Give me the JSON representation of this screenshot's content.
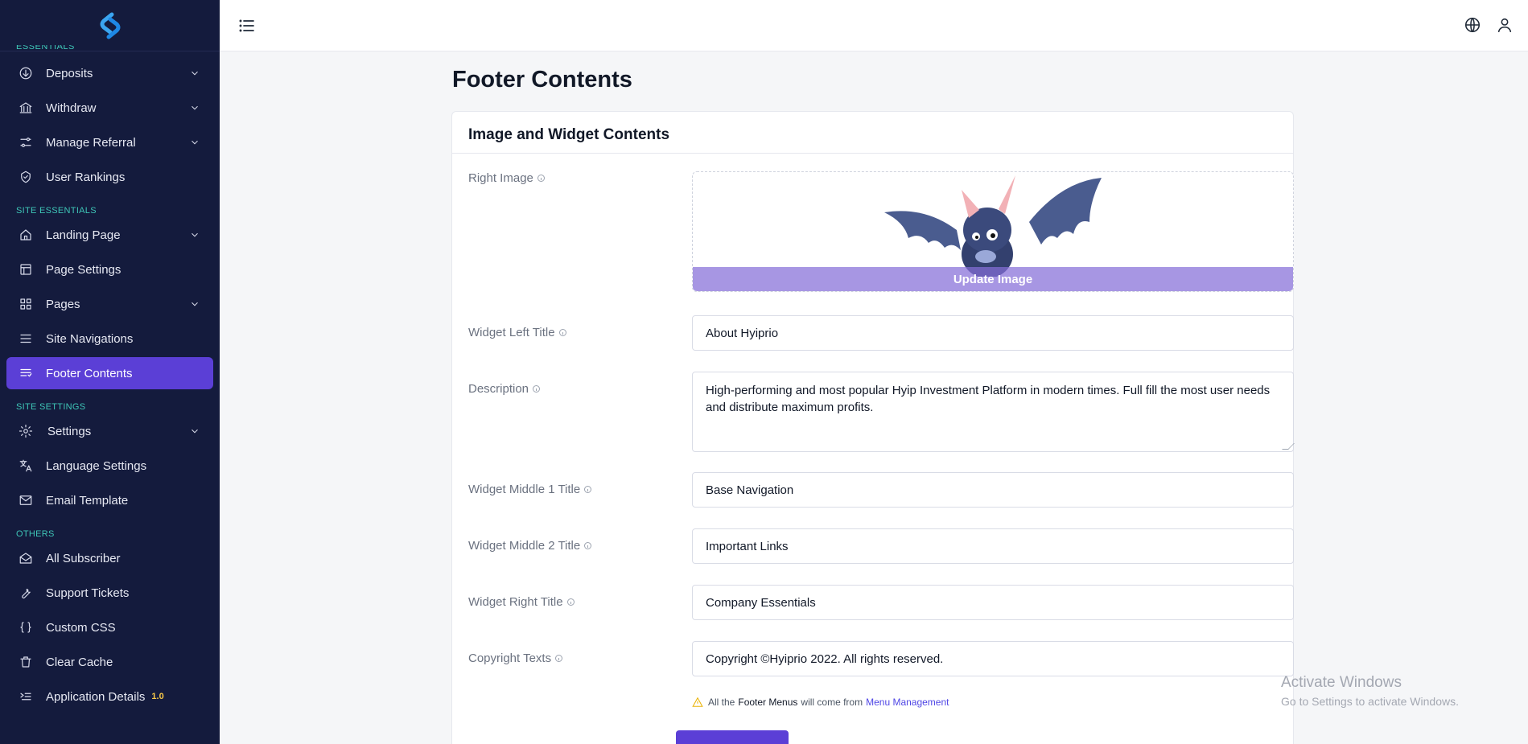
{
  "sidebar": {
    "cut_section": "ESSENTIALS",
    "items_top": [
      {
        "label": "Deposits",
        "icon": "arrow-down-circle-icon",
        "chevron": true
      },
      {
        "label": "Withdraw",
        "icon": "bank-icon",
        "chevron": true
      },
      {
        "label": "Manage Referral",
        "icon": "sliders-icon",
        "chevron": true
      },
      {
        "label": "User Rankings",
        "icon": "badge-icon",
        "chevron": false
      }
    ],
    "section_site_essentials": "SITE ESSENTIALS",
    "items_essentials": [
      {
        "label": "Landing Page",
        "icon": "home-icon",
        "chevron": true
      },
      {
        "label": "Page Settings",
        "icon": "layout-icon",
        "chevron": false
      },
      {
        "label": "Pages",
        "icon": "grid-icon",
        "chevron": true
      },
      {
        "label": "Site Navigations",
        "icon": "menu-icon",
        "chevron": false
      },
      {
        "label": "Footer Contents",
        "icon": "list-lines-icon",
        "chevron": false,
        "active": true
      }
    ],
    "section_site_settings": "SITE SETTINGS",
    "items_settings": [
      {
        "label": "Settings",
        "icon": "gear-icon",
        "chevron": true
      },
      {
        "label": "Language Settings",
        "icon": "translate-icon",
        "chevron": false
      },
      {
        "label": "Email Template",
        "icon": "mail-icon",
        "chevron": false
      }
    ],
    "section_others": "OTHERS",
    "items_others": [
      {
        "label": "All Subscriber",
        "icon": "mail-open-icon",
        "chevron": false
      },
      {
        "label": "Support Tickets",
        "icon": "wrench-icon",
        "chevron": false
      },
      {
        "label": "Custom CSS",
        "icon": "braces-icon",
        "chevron": false
      },
      {
        "label": "Clear Cache",
        "icon": "trash-icon",
        "chevron": false
      },
      {
        "label": "Application Details",
        "icon": "terminal-icon",
        "chevron": false,
        "badge": "1.0"
      }
    ]
  },
  "page": {
    "title": "Footer Contents",
    "card_title": "Image and Widget Contents"
  },
  "form": {
    "right_image_label": "Right Image",
    "update_image_label": "Update Image",
    "widget_left_title_label": "Widget Left Title",
    "widget_left_title_value": "About Hyiprio",
    "description_label": "Description",
    "description_value": "High-performing and most popular Hyip Investment Platform in modern times. Full fill the most user needs and distribute maximum profits.",
    "widget_middle1_label": "Widget Middle 1 Title",
    "widget_middle1_value": "Base Navigation",
    "widget_middle2_label": "Widget Middle 2 Title",
    "widget_middle2_value": "Important Links",
    "widget_right_label": "Widget Right Title",
    "widget_right_value": "Company Essentials",
    "copyright_label": "Copyright Texts",
    "copyright_value": "Copyright ©Hyiprio 2022. All rights reserved.",
    "note_prefix": "All the",
    "note_bold": "Footer Menus",
    "note_mid": "will come from",
    "note_link": "Menu Management"
  },
  "watermark": {
    "line1": "Activate Windows",
    "line2": "Go to Settings to activate Windows."
  },
  "colors": {
    "sidebar_bg": "#141b3d",
    "accent": "#5b3fd6",
    "section_label": "#3ec6b7",
    "badge": "#f7c948"
  }
}
